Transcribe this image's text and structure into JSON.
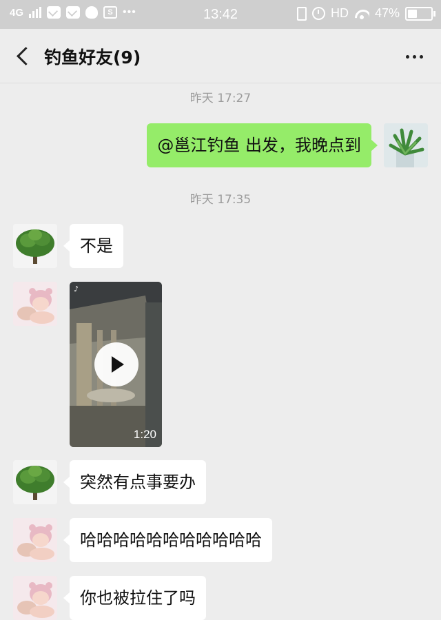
{
  "status_bar": {
    "network": "4G",
    "time": "13:42",
    "hd": "HD",
    "battery_percent": "47%",
    "battery_level": 0.47,
    "notification_icons": [
      "mail-icon",
      "mail-icon",
      "qq-penguin-icon",
      "s-app-icon",
      "video-icon",
      "more-dots-icon"
    ]
  },
  "header": {
    "title": "钓鱼好友(9)"
  },
  "messages": [
    {
      "type": "timestamp",
      "text": "昨天 17:27"
    },
    {
      "type": "text",
      "side": "right",
      "avatar": "plant",
      "text": "@邕江钓鱼  出发，我晚点到"
    },
    {
      "type": "timestamp",
      "text": "昨天 17:35"
    },
    {
      "type": "text",
      "side": "left",
      "avatar": "tree",
      "text": "不是"
    },
    {
      "type": "video",
      "side": "left",
      "avatar": "baby",
      "duration": "1:20"
    },
    {
      "type": "text",
      "side": "left",
      "avatar": "tree",
      "text": "突然有点事要办"
    },
    {
      "type": "text",
      "side": "left",
      "avatar": "baby",
      "text": "哈哈哈哈哈哈哈哈哈哈哈"
    },
    {
      "type": "text",
      "side": "left",
      "avatar": "baby",
      "text": "你也被拉住了吗"
    }
  ],
  "colors": {
    "chat_bg": "#ededed",
    "sent_bubble": "#95ec69",
    "received_bubble": "#ffffff",
    "status_bar": "#cfcfcf",
    "timestamp_text": "#9b9b9b"
  }
}
